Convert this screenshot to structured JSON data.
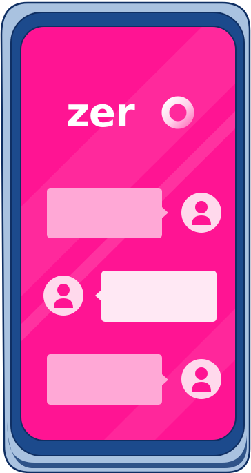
{
  "brand": {
    "wordmark_prefix": "zer",
    "wordmark_full": "zero",
    "logo_o_icon": "gradient-ring-o"
  },
  "conversation": {
    "messages": [
      {
        "side": "right",
        "style": "soft-pink",
        "avatar_icon": "user-icon"
      },
      {
        "side": "left",
        "style": "light",
        "avatar_icon": "user-icon"
      },
      {
        "side": "right",
        "style": "soft-pink",
        "avatar_icon": "user-icon"
      }
    ]
  },
  "colors": {
    "screen": "#ff1493",
    "screen_shine": "#ff4fad",
    "frame_outer": "#9fb9d9",
    "frame_inner": "#1c4a8c",
    "frame_shadow": "#123a74",
    "bubble_soft": "#ffa8d6",
    "bubble_light": "#ffe8f4",
    "avatar_bg": "#ffd9ec",
    "avatar_fg": "#ff1493"
  }
}
